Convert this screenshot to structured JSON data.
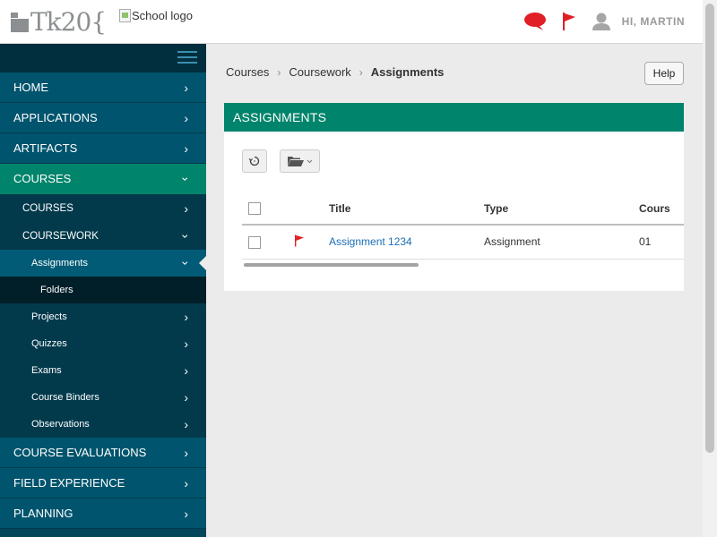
{
  "header": {
    "logo_text": "Tk20{",
    "school_logo_alt": "School logo",
    "greeting": "HI, MARTIN",
    "icons": [
      "speech-bubble-icon",
      "flag-icon",
      "user-icon"
    ],
    "colors": {
      "alert_red": "#e01f26",
      "brand_gray": "#8c8f91"
    }
  },
  "sidebar": {
    "colors": {
      "bg": "#01546d",
      "active": "#00846b",
      "sub_bg": "#023a4c",
      "subsub_bg": "#011f29"
    },
    "items": [
      {
        "label": "HOME"
      },
      {
        "label": "APPLICATIONS"
      },
      {
        "label": "ARTIFACTS"
      },
      {
        "label": "COURSES"
      },
      {
        "label": "COURSES"
      },
      {
        "label": "COURSEWORK"
      },
      {
        "label": "Assignments"
      },
      {
        "label": "Folders"
      },
      {
        "label": "Projects"
      },
      {
        "label": "Quizzes"
      },
      {
        "label": "Exams"
      },
      {
        "label": "Course Binders"
      },
      {
        "label": "Observations"
      },
      {
        "label": "COURSE EVALUATIONS"
      },
      {
        "label": "FIELD EXPERIENCE"
      },
      {
        "label": "PLANNING"
      }
    ]
  },
  "breadcrumb": {
    "items": [
      "Courses",
      "Coursework",
      "Assignments"
    ],
    "separator": "›"
  },
  "help_label": "Help",
  "panel": {
    "title": "ASSIGNMENTS",
    "columns": [
      "Title",
      "Type",
      "Cours"
    ],
    "rows": [
      {
        "title": "Assignment 1234",
        "type": "Assignment",
        "course": "01",
        "flagged": true
      }
    ]
  }
}
